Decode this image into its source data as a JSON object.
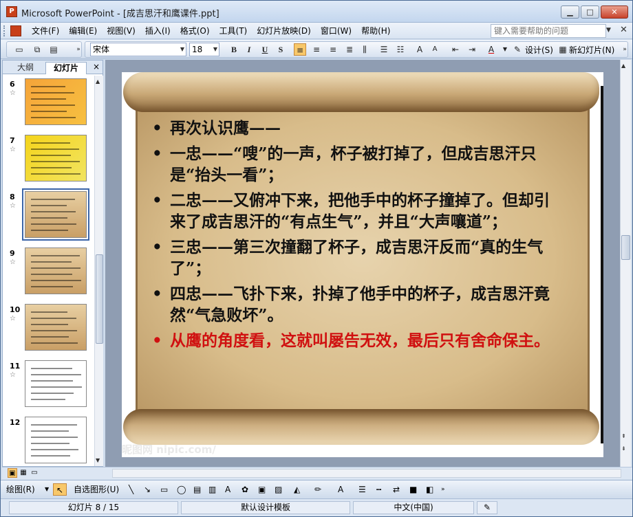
{
  "window": {
    "title": "Microsoft PowerPoint - [成吉思汗和鹰课件.ppt]",
    "app_icon_label": "P"
  },
  "menu": {
    "items": [
      "文件(F)",
      "编辑(E)",
      "视图(V)",
      "插入(I)",
      "格式(O)",
      "工具(T)",
      "幻灯片放映(D)",
      "窗口(W)",
      "帮助(H)"
    ],
    "help_placeholder": "键入需要帮助的问题"
  },
  "toolbar": {
    "font_name": "宋体",
    "font_size": "18",
    "bold": "B",
    "italic": "I",
    "underline": "U",
    "shadow": "S",
    "design_label": "设计(S)",
    "new_slide_label": "新幻灯片(N)"
  },
  "left_pane": {
    "tab_outline": "大纲",
    "tab_slides": "幻灯片",
    "close": "×",
    "thumbnails": [
      {
        "number": "6",
        "style": "orange"
      },
      {
        "number": "7",
        "style": "yellow"
      },
      {
        "number": "8",
        "style": "scroll",
        "selected": true
      },
      {
        "number": "9",
        "style": "scroll"
      },
      {
        "number": "10",
        "style": "scroll"
      },
      {
        "number": "11",
        "style": "white"
      },
      {
        "number": "12",
        "style": "red"
      }
    ]
  },
  "slide": {
    "bullets": [
      "再次认识鹰——",
      "一忠——“嗖”的一声，杯子被打掉了，但成吉思汗只是“抬头一看”；",
      "二忠——又俯冲下来，把他手中的杯子撞掉了。但却引来了成吉思汗的“有点生气”，并且“大声嚷道”；",
      "三忠——第三次撞翻了杯子，成吉思汗反而“真的生气了”；",
      "四忠——飞扑下来，扑掉了他手中的杯子，成吉思汗竟然“气急败坏”。",
      "从鹰的角度看，这就叫屡告无效，最后只有舍命保主。"
    ],
    "highlight_color": "#d01010",
    "watermark": "昵图网 nipic.com/"
  },
  "drawing_toolbar": {
    "draw_label": "绘图(R)",
    "autoshapes_label": "自选图形(U)"
  },
  "status": {
    "slide_position": "幻灯片 8 / 15",
    "template": "默认设计模板",
    "language": "中文(中国)"
  }
}
